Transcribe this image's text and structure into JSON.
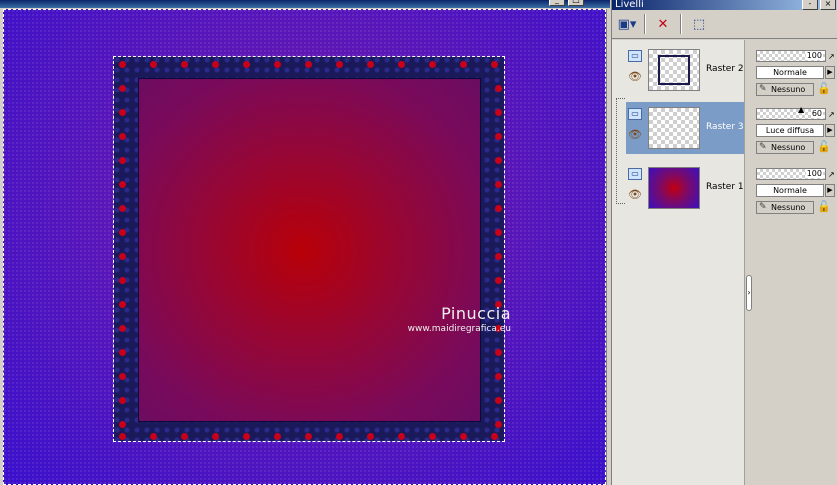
{
  "layers_panel": {
    "title": "Livelli",
    "toolbar": [
      "new-layer-icon",
      "delete-layer-icon",
      "selection-icon"
    ]
  },
  "layers": [
    {
      "name": "Raster 2",
      "opacity": "100",
      "blend": "Normale",
      "mask": "Nessuno",
      "selected": false
    },
    {
      "name": "Raster 3",
      "opacity": "60",
      "blend": "Luce diffusa",
      "mask": "Nessuno",
      "selected": true
    },
    {
      "name": "Raster 1",
      "opacity": "100",
      "blend": "Normale",
      "mask": "Nessuno",
      "selected": false
    }
  ],
  "watermark": {
    "name": "Pinuccia",
    "url": "www.maidiregrafica.eu"
  },
  "colors": {
    "background_purple": "#4a14c4",
    "frame_navy": "#1a1a5a",
    "center_red": "#b80008",
    "selection_blue": "#7b9cc6"
  }
}
